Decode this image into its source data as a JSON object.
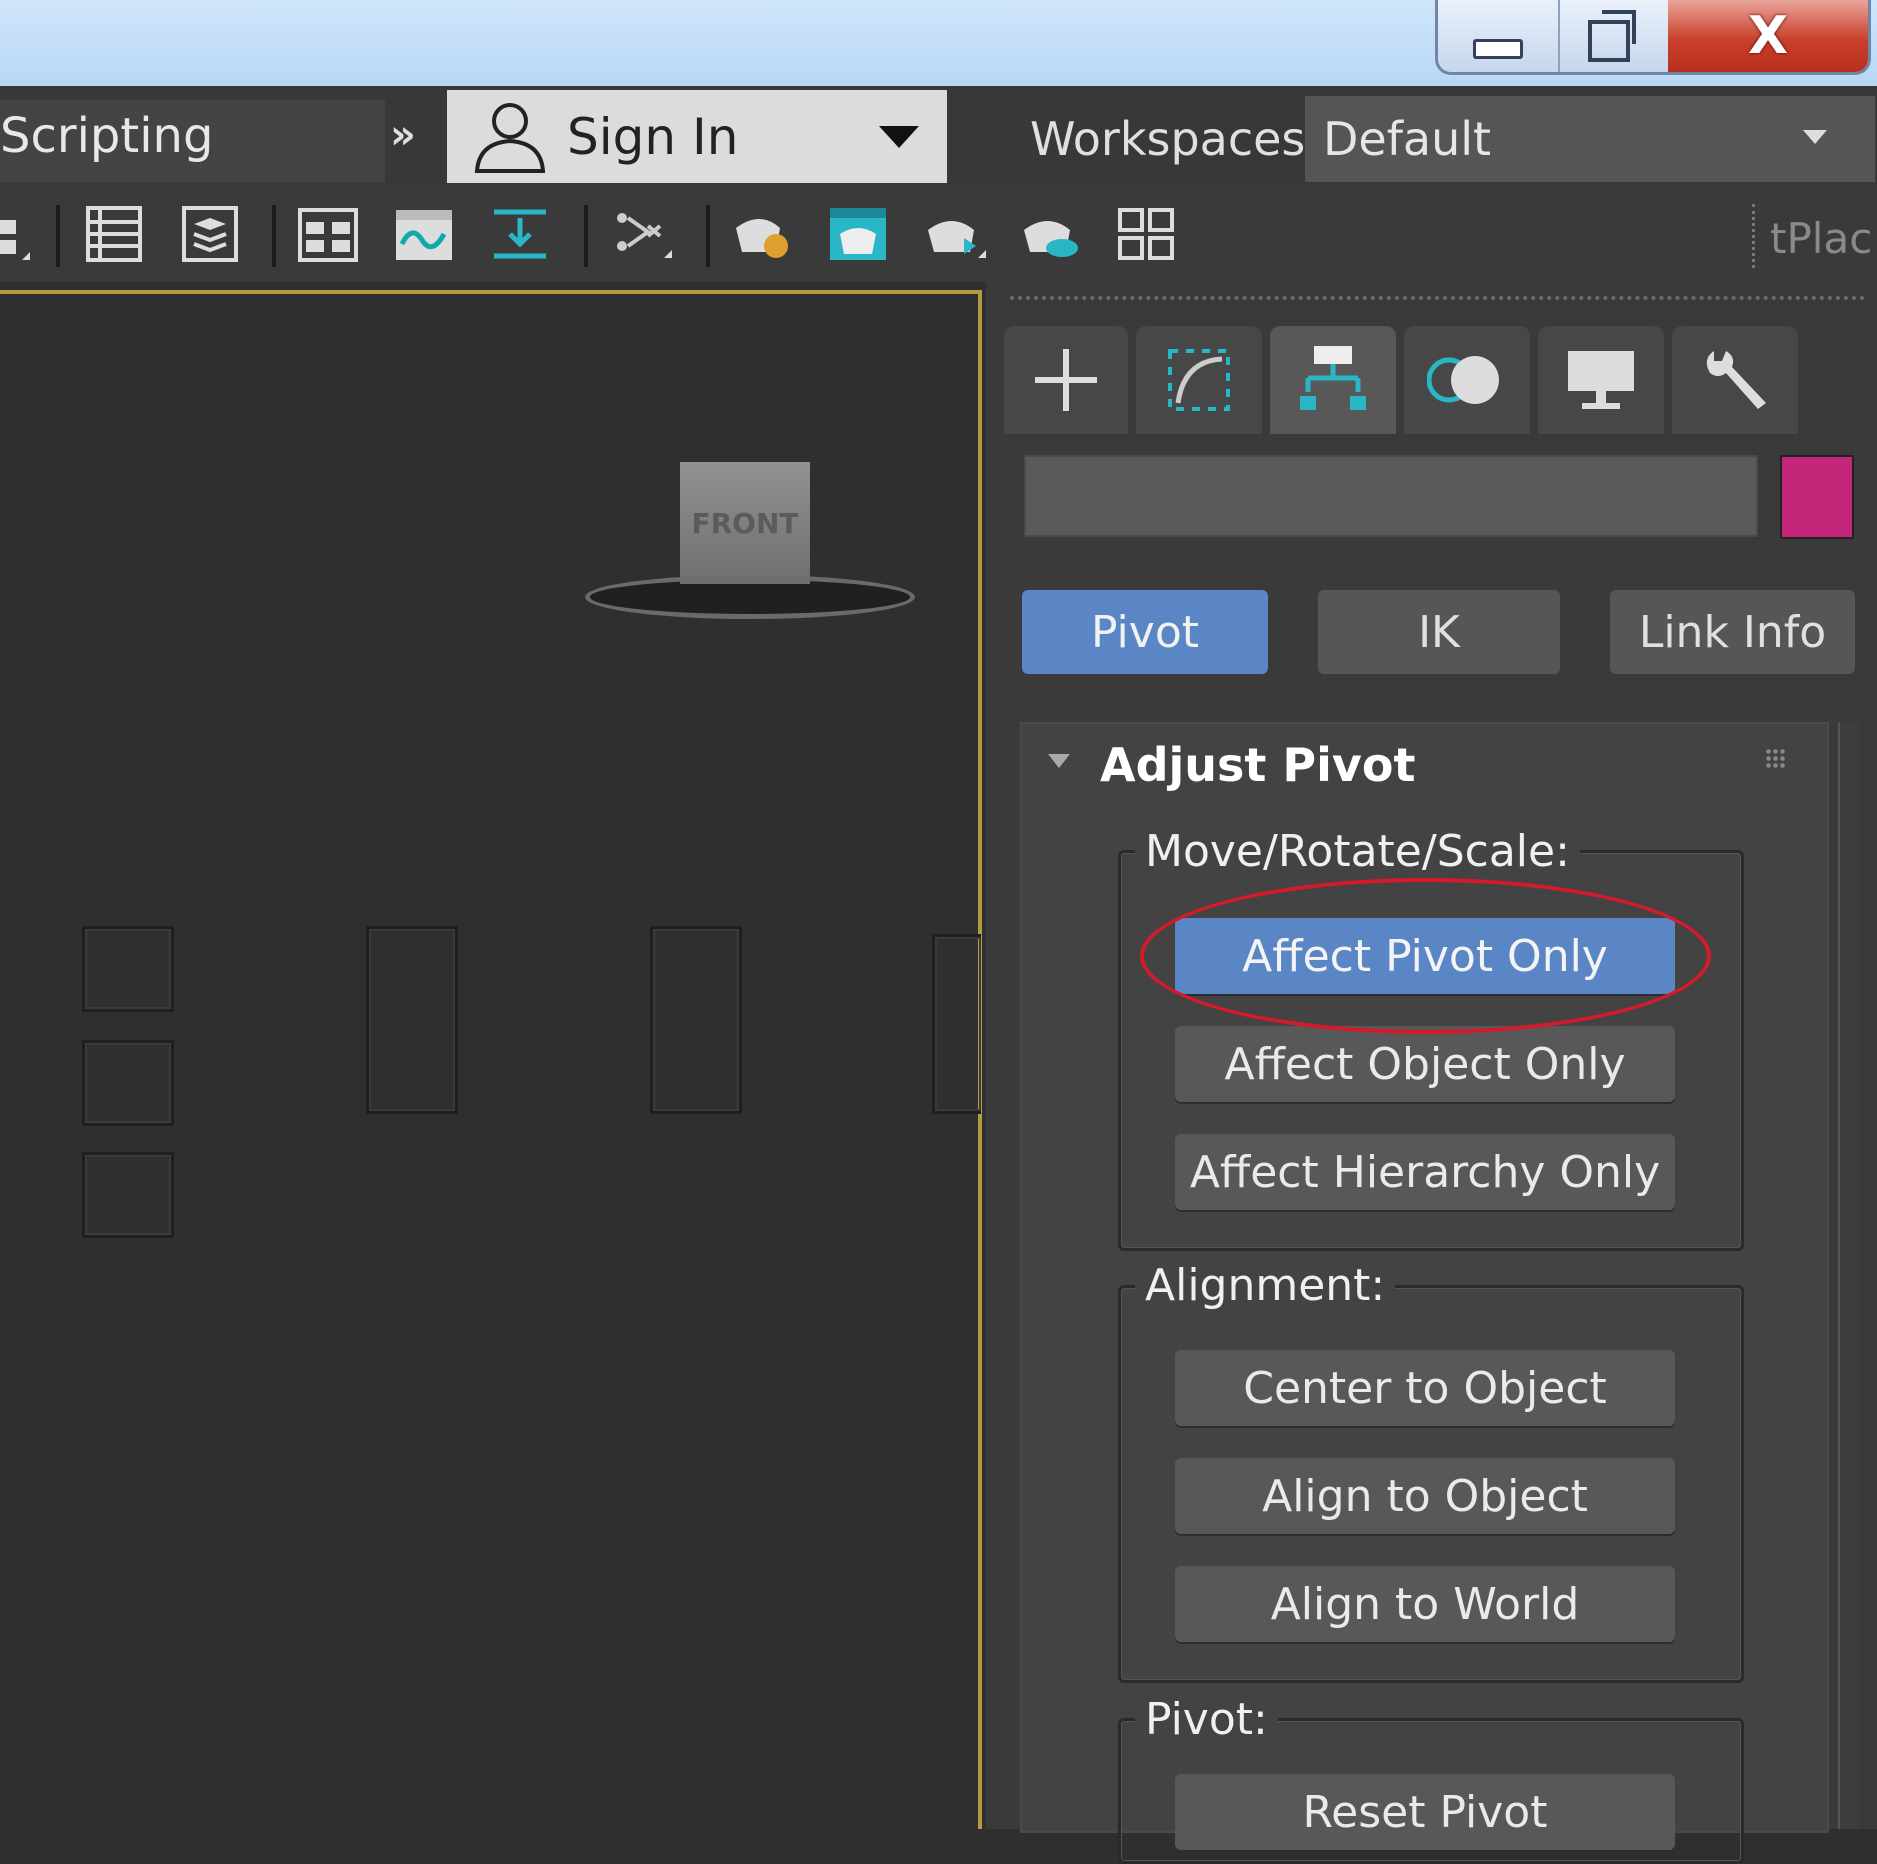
{
  "menu": {
    "scripting_label": "Scripting",
    "overflow_label": "»",
    "signin_label": "Sign In",
    "workspaces_label": "Workspaces:",
    "workspace_value": "Default"
  },
  "toolbar": {
    "truncated_label": "tPlac"
  },
  "viewport": {
    "viewcube_label": "FRONT"
  },
  "command_panel": {
    "tabs": [
      {
        "name": "create",
        "icon": "plus-icon"
      },
      {
        "name": "modify",
        "icon": "modify-curve-icon"
      },
      {
        "name": "hierarchy",
        "icon": "hierarchy-icon",
        "active": true
      },
      {
        "name": "motion",
        "icon": "motion-icon"
      },
      {
        "name": "display",
        "icon": "monitor-icon"
      },
      {
        "name": "utilities",
        "icon": "wrench-icon"
      }
    ],
    "object_color": "#c4267a",
    "subtabs": [
      "Pivot",
      "IK",
      "Link Info"
    ],
    "rollout_title": "Adjust Pivot",
    "move_group_label": "Move/Rotate/Scale:",
    "move_buttons": [
      "Affect Pivot Only",
      "Affect Object Only",
      "Affect Hierarchy Only"
    ],
    "alignment_group_label": "Alignment:",
    "alignment_buttons": [
      "Center to Object",
      "Align to Object",
      "Align to World"
    ],
    "pivot_group_label": "Pivot:",
    "pivot_buttons": [
      "Reset Pivot"
    ]
  },
  "colors": {
    "accent_blue": "#5b86c6",
    "highlight_red": "#d51a2a",
    "viewport_border": "#b59a45"
  }
}
